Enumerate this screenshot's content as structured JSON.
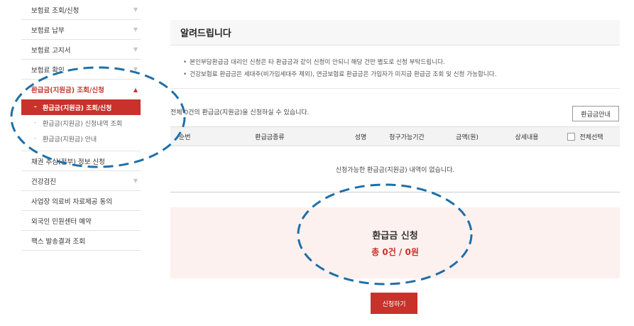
{
  "sidebar": {
    "items": [
      {
        "label": "보험료 조회/신청"
      },
      {
        "label": "보험료 납부"
      },
      {
        "label": "보험료 고지서"
      },
      {
        "label": "보험료 확인"
      }
    ],
    "active_group": {
      "label": "환급금(지원금) 조회/신청",
      "sub_items": [
        {
          "label": "환급금(지원금) 조회/신청"
        },
        {
          "label": "환급금(지원금) 신청내역 조회"
        },
        {
          "label": "환급금(지원금) 안내"
        }
      ]
    },
    "items_after": [
      {
        "label": "채권 추심(전부) 정보 신청"
      },
      {
        "label": "건강검진"
      },
      {
        "label": "사업장 의료비 자료제공 동의"
      },
      {
        "label": "외국인 민원센터 예약"
      },
      {
        "label": "팩스 발송결과 조회"
      }
    ]
  },
  "notice": {
    "title": "알려드립니다",
    "lines": [
      "본인부담환급금 대리인 신청은 타 환급금과 같이 신청이 안되니 해당 건만 별도로 신청 부탁드립니다.",
      "건강보험료 환급금은 세대주(비가입세대주 제외), 연금보험료 환급금은 가입자가 미지급 환급금 조회 및 신청 가능합니다."
    ]
  },
  "summary": {
    "count_text": "전체 0건의 환급금(지원금)을 신청하실 수 있습니다.",
    "guide_button": "환급금안내"
  },
  "table": {
    "headers": [
      "순번",
      "환급금종류",
      "성명",
      "청구가능기간",
      "금액(원)",
      "상세내용",
      "전체선택"
    ],
    "empty_message": "신청가능한 환급금(지원금) 내역이 없습니다."
  },
  "apply": {
    "title": "환급금 신청",
    "total": "총 0건 / 0원",
    "button": "신청하기"
  },
  "colors": {
    "accent": "#c8322b",
    "annotation": "#1f6fa8"
  }
}
